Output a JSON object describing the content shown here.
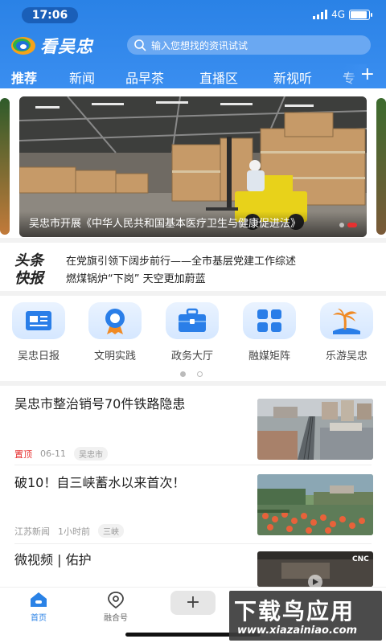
{
  "status_bar": {
    "time": "17:06",
    "network": "4G",
    "battery_level": 0.9
  },
  "header": {
    "app_name": "看吴忠",
    "search_placeholder": "输入您想找的资讯试试",
    "channels": [
      "推荐",
      "新闻",
      "品早茶",
      "直播区",
      "新视听",
      "专"
    ],
    "active_channel": "推荐",
    "add_channel_icon": "plus-icon"
  },
  "banner": {
    "caption": "吴忠市开展《中华人民共和国基本医疗卫生与健康促进法》",
    "slide_count": 2,
    "active_slide": 2,
    "active_dot_color": "#e63030"
  },
  "flash": {
    "logo_line1": "头条",
    "logo_line2": "快报",
    "headlines": [
      "在党旗引领下阔步前行——全市基层党建工作综述",
      "燃煤锅炉“下岗” 天空更加蔚蓝"
    ]
  },
  "quick_entries": [
    {
      "label": "吴忠日报",
      "icon": "newspaper-icon"
    },
    {
      "label": "文明实践",
      "icon": "medal-icon"
    },
    {
      "label": "政务大厅",
      "icon": "briefcase-icon"
    },
    {
      "label": "融媒矩阵",
      "icon": "grid-icon"
    },
    {
      "label": "乐游吴忠",
      "icon": "palm-tree-icon"
    }
  ],
  "quick_pages": {
    "count": 2,
    "active": 1
  },
  "news": [
    {
      "title": "吴忠市整治销号70件铁路隐患",
      "pin": "置顶",
      "source": "",
      "time": "06-11",
      "tag": "吴忠市"
    },
    {
      "title": "破10！自三峡蓄水以来首次！",
      "pin": "",
      "source": "江苏新闻",
      "time": "1小时前",
      "tag": "三峡"
    },
    {
      "title": "微视频 | 佑护",
      "pin": "",
      "source": "",
      "time": "",
      "tag": "",
      "thumb_badge": "CNC"
    }
  ],
  "tabbar": {
    "items": [
      {
        "label": "首页",
        "icon": "home-icon"
      },
      {
        "label": "融合号",
        "icon": "location-pin-icon"
      }
    ],
    "add_label": "+",
    "active_tab": "首页"
  },
  "watermark": {
    "main": "下载鸟应用",
    "sub": "www.xiazainiao.com"
  },
  "colors": {
    "brand_blue": "#2a82e6",
    "accent_red": "#e63030"
  }
}
